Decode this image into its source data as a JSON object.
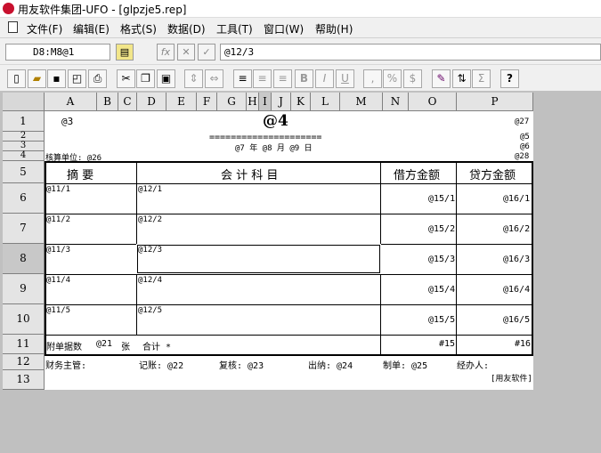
{
  "title": "用友软件集团-UFO - [glpzje5.rep]",
  "menu": [
    "文件(F)",
    "编辑(E)",
    "格式(S)",
    "数据(D)",
    "工具(T)",
    "窗口(W)",
    "帮助(H)"
  ],
  "formula": {
    "cell_ref": "D8:M8@1",
    "fx": "fx",
    "cancel": "✕",
    "ok": "✓",
    "content": "@12/3"
  },
  "toolbar": {
    "bold": "B",
    "italic": "I",
    "underline": "U",
    "comma": ",",
    "percent": "%",
    "currency": "$",
    "help": "?"
  },
  "columns": [
    "A",
    "B",
    "C",
    "D",
    "E",
    "F",
    "G",
    "H",
    "I",
    "J",
    "K",
    "L",
    "M",
    "N",
    "O",
    "P"
  ],
  "rows": [
    "1",
    "2",
    "3",
    "4",
    "5",
    "6",
    "7",
    "8",
    "9",
    "10",
    "11",
    "12",
    "13"
  ],
  "cells": {
    "r1_left": "@3",
    "r1_title": "@4",
    "r1_right": "@27",
    "r2_right": "@5",
    "r3_double": "=====================",
    "r3_date": "@7 年 @8 月 @9 日",
    "r3_right": "@6",
    "r4_unit": "核算单位: @26",
    "r4_right": "@28",
    "h_summary": "摘     要",
    "h_subject": "会 计 科 目",
    "h_debit": "借方金额",
    "h_credit": "贷方金额",
    "r6a": "@11/1",
    "r6d": "@12/1",
    "r6n": "@15/1",
    "r6p": "@16/1",
    "r7a": "@11/2",
    "r7d": "@12/2",
    "r7n": "@15/2",
    "r7p": "@16/2",
    "r8a": "@11/3",
    "r8d": "@12/3",
    "r8n": "@15/3",
    "r8p": "@16/3",
    "r9a": "@11/4",
    "r9d": "@12/4",
    "r9n": "@15/4",
    "r9p": "@16/4",
    "r10a": "@11/5",
    "r10d": "@12/5",
    "r10n": "@15/5",
    "r10p": "@16/5",
    "r11_attach": "附单据数",
    "r11_count": "@21",
    "r11_zhang": "张",
    "r11_total": "合计 *",
    "r11_n": "#15",
    "r11_p": "#16",
    "r12_manager": "财务主管:",
    "r12_book": "记账: @22",
    "r12_check": "复核: @23",
    "r12_cash": "出纳: @24",
    "r12_maker": "制单: @25",
    "r12_handler": "经办人:",
    "r13_brand": "[用友软件]"
  }
}
